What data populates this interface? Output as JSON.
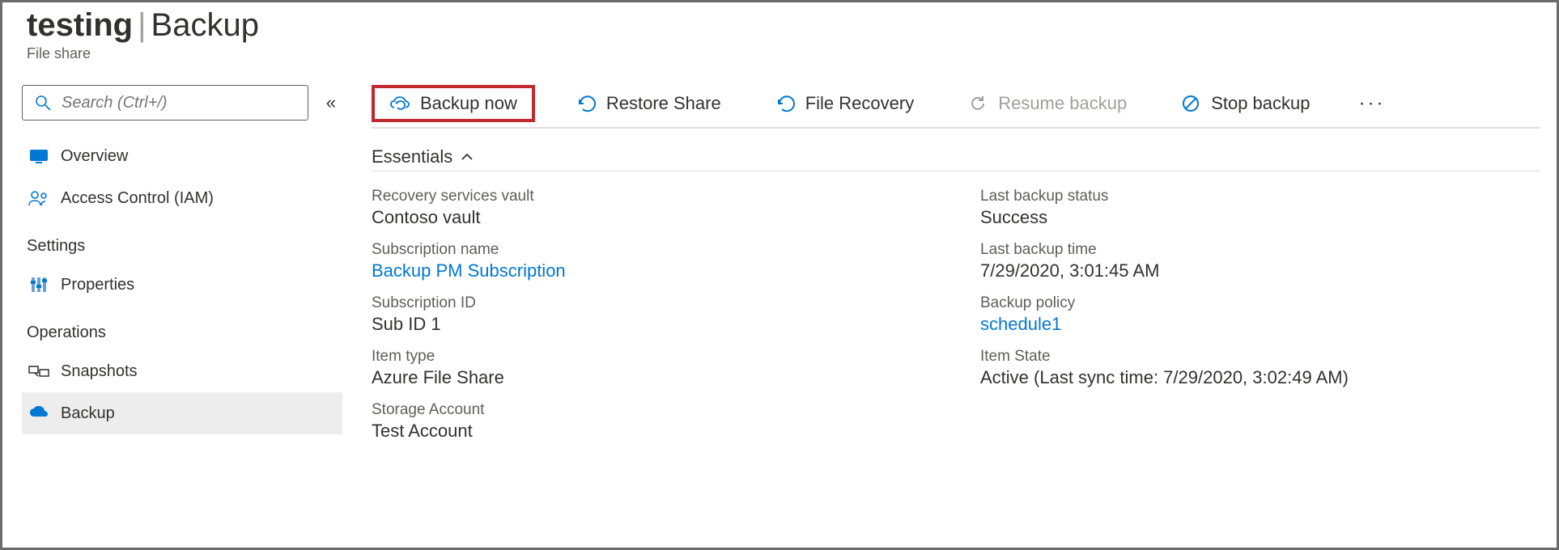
{
  "header": {
    "resource_name": "testing",
    "page_name": "Backup",
    "resource_type": "File share"
  },
  "sidebar": {
    "search_placeholder": "Search (Ctrl+/)",
    "items": [
      {
        "label": "Overview"
      },
      {
        "label": "Access Control (IAM)"
      }
    ],
    "section_settings": "Settings",
    "settings_items": [
      {
        "label": "Properties"
      }
    ],
    "section_operations": "Operations",
    "operations_items": [
      {
        "label": "Snapshots"
      },
      {
        "label": "Backup"
      }
    ]
  },
  "commands": {
    "backup_now": "Backup now",
    "restore_share": "Restore Share",
    "file_recovery": "File Recovery",
    "resume_backup": "Resume backup",
    "stop_backup": "Stop backup"
  },
  "essentials": {
    "header": "Essentials",
    "left": {
      "recovery_vault_label": "Recovery services vault",
      "recovery_vault_value": "Contoso vault",
      "subscription_name_label": "Subscription name",
      "subscription_name_value": "Backup PM Subscription",
      "subscription_id_label": "Subscription ID",
      "subscription_id_value": "Sub ID 1",
      "item_type_label": "Item type",
      "item_type_value": "Azure File Share",
      "storage_account_label": "Storage Account",
      "storage_account_value": "Test Account"
    },
    "right": {
      "last_backup_status_label": "Last backup status",
      "last_backup_status_value": "Success",
      "last_backup_time_label": "Last backup time",
      "last_backup_time_value": "7/29/2020, 3:01:45 AM",
      "backup_policy_label": "Backup policy",
      "backup_policy_value": "schedule1",
      "item_state_label": "Item State",
      "item_state_value": "Active (Last sync time: 7/29/2020, 3:02:49 AM)"
    }
  }
}
